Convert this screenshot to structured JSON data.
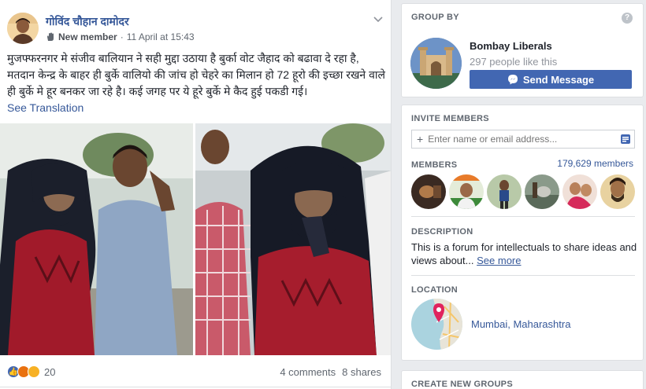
{
  "post": {
    "author": "गोविंद चौहान दामोदर",
    "role": "New member",
    "time": "11 April at 15:43",
    "text": "मुजफ्फरनगर मे संजीव बालियान ने सही मुद्दा उठाया है बुर्का वोट जैहाद को बढावा दे रहा है, मतदान केन्द्र के बाहर ही बुर्के वालियो की जांच हो चेहरे का मिलान हो 72 हूरो की इच्छा रखने वाले ही बुर्के मे हूर बनकर जा रहे है। कई जगह पर ये हूरे बुर्के मे कैद हुई पकडी गई।",
    "see_translation": "See Translation",
    "reaction_count": "20",
    "comments": "4 comments",
    "shares": "8 shares"
  },
  "sidebar": {
    "group_by": {
      "title": "GROUP BY",
      "help": "?",
      "name": "Bombay Liberals",
      "likes": "297 people like this",
      "send_label": "Send Message"
    },
    "invite": {
      "title": "INVITE MEMBERS",
      "placeholder": "Enter name or email address...",
      "members_title": "MEMBERS",
      "members_count": "179,629 members",
      "description_title": "DESCRIPTION",
      "description": "This is a forum for intellectuals to share ideas and views about...",
      "see_more": "See more",
      "location_title": "LOCATION",
      "location": "Mumbai, Maharashtra"
    },
    "create": {
      "title": "CREATE NEW GROUPS"
    }
  },
  "colors": {
    "brand": "#4267b2",
    "link": "#365899",
    "background": "#e9ebee"
  }
}
